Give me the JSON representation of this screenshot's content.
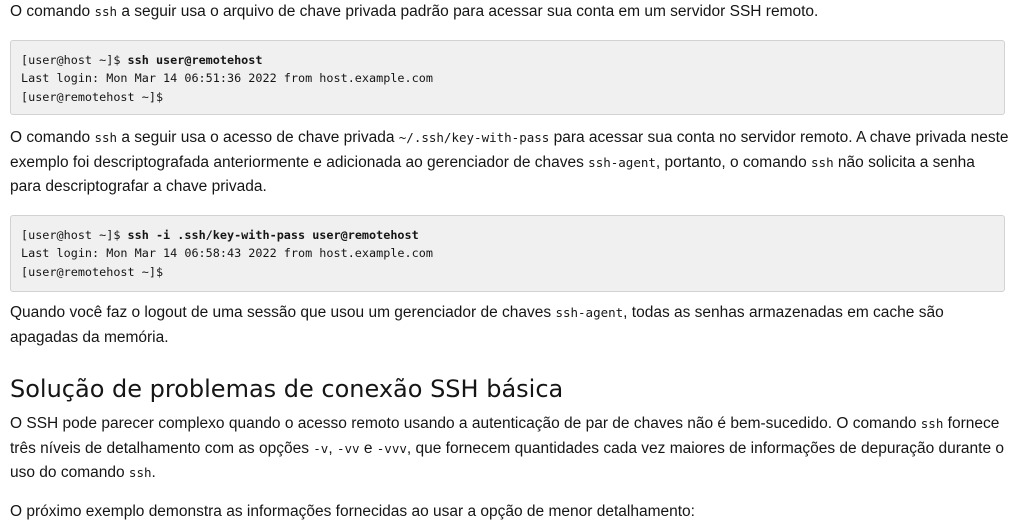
{
  "p1": {
    "a": "O comando ",
    "code1": "ssh",
    "b": " a seguir usa o arquivo de chave privada padrão para acessar sua conta em um servidor SSH remoto."
  },
  "block1": {
    "line1_prompt": "[user@host ~]$ ",
    "line1_cmd": "ssh user@remotehost",
    "line2": "Last login: Mon Mar 14 06:51:36 2022 from host.example.com",
    "line3": "[user@remotehost ~]$"
  },
  "p2": {
    "a": "O comando ",
    "code1": "ssh",
    "b": " a seguir usa o acesso de chave privada ",
    "code2": "~/.ssh/key-with-pass",
    "c": " para acessar sua conta no servidor remoto. A chave privada neste exemplo foi descriptografada anteriormente e adicionada ao gerenciador de chaves ",
    "code3": "ssh-agent",
    "d": ", portanto, o comando ",
    "code4": "ssh",
    "e": " não solicita a senha para descriptografar a chave privada."
  },
  "block2": {
    "line1_prompt": "[user@host ~]$ ",
    "line1_cmd": "ssh -i .ssh/key-with-pass user@remotehost",
    "line2": "Last login: Mon Mar 14 06:58:43 2022 from host.example.com",
    "line3": "[user@remotehost ~]$"
  },
  "p3": {
    "a": "Quando você faz o logout de uma sessão que usou um gerenciador de chaves ",
    "code1": "ssh-agent",
    "b": ", todas as senhas armazenadas em cache são apagadas da memória."
  },
  "heading": "Solução de problemas de conexão SSH básica",
  "p4": {
    "a": "O SSH pode parecer complexo quando o acesso remoto usando a autenticação de par de chaves não é bem-sucedido. O comando ",
    "code1": "ssh",
    "b": " fornece três níveis de detalhamento com as opções ",
    "code2": "-v",
    "c": ", ",
    "code3": "-vv",
    "d": " e ",
    "code4": "-vvv",
    "e": ", que fornecem quantidades cada vez maiores de informações de depuração durante o uso do comando ",
    "code5": "ssh",
    "f": "."
  },
  "p5": {
    "text": "O próximo exemplo demonstra as informações fornecidas ao usar a opção de menor detalhamento:"
  }
}
